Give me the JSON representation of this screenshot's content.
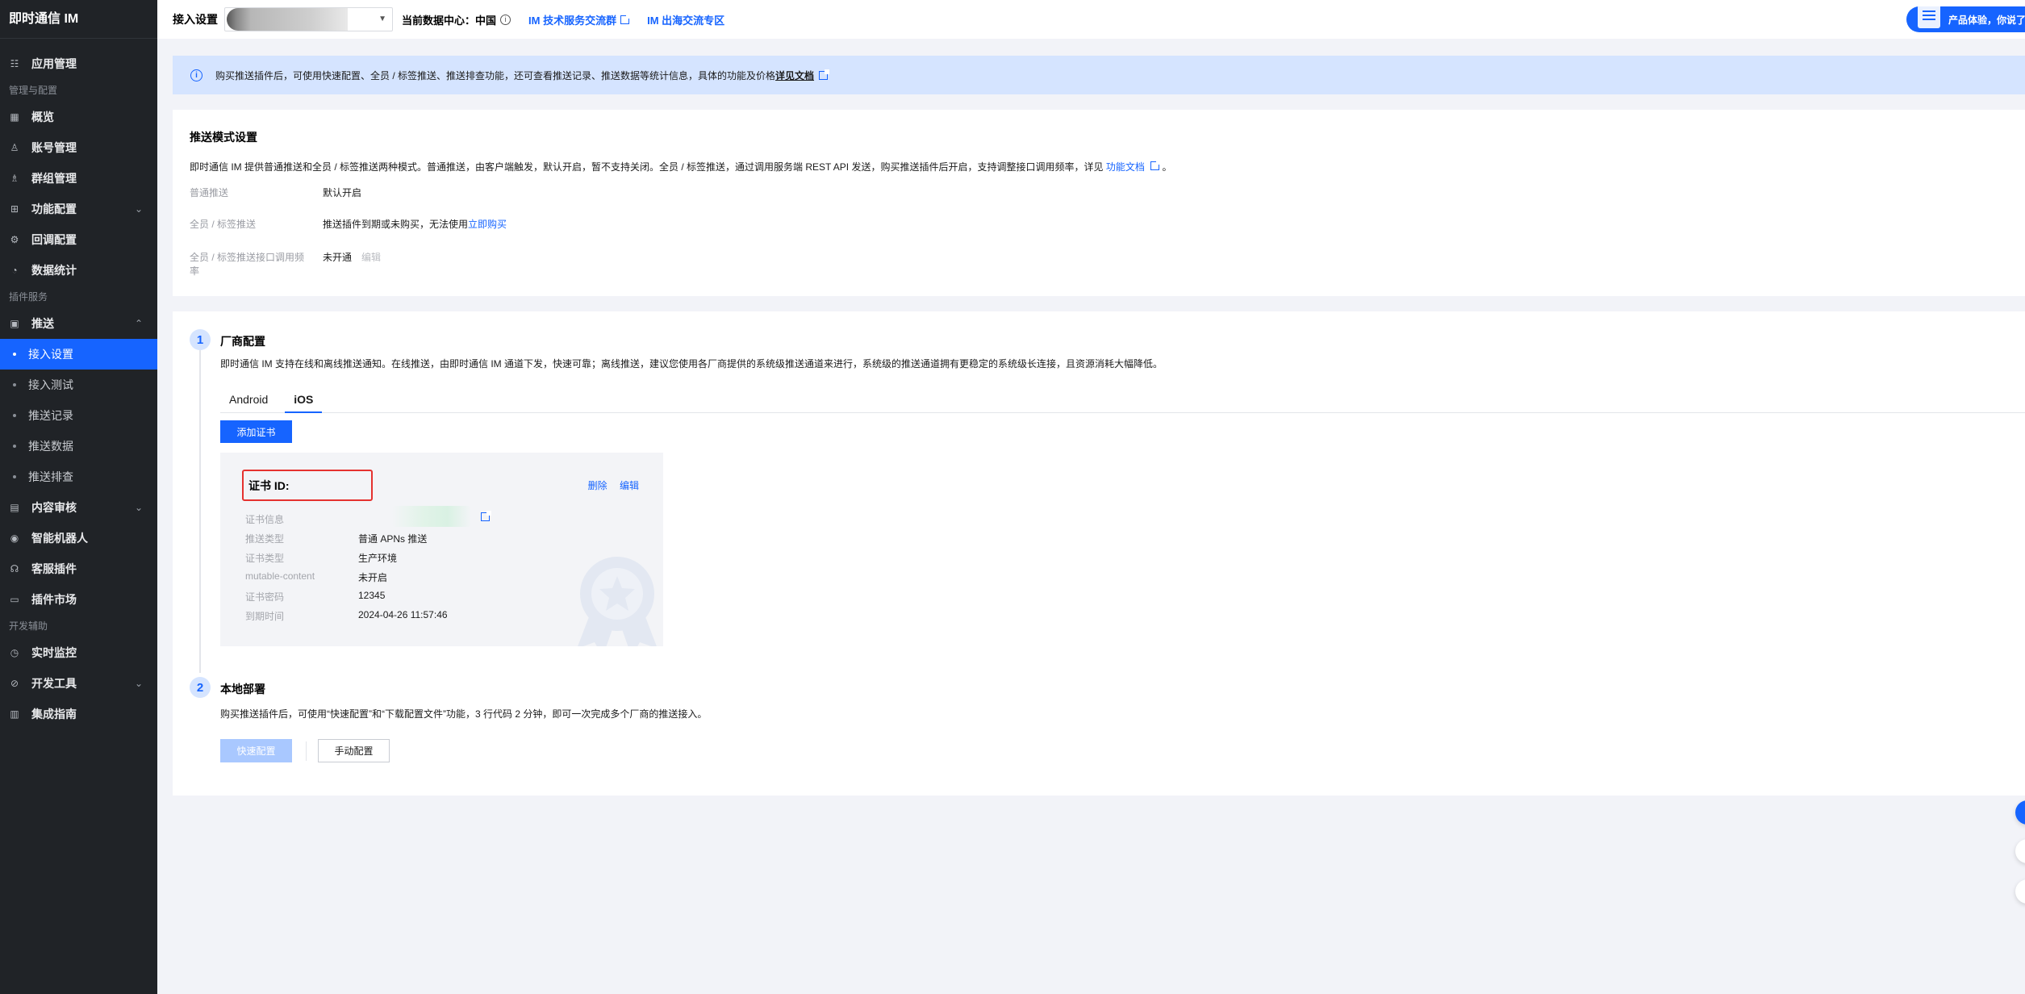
{
  "sidebar": {
    "brand": "即时通信 IM",
    "app_mgmt": "应用管理",
    "group_mgmt_label": "管理与配置",
    "overview": "概览",
    "account": "账号管理",
    "group": "群组管理",
    "feature": "功能配置",
    "callback": "回调配置",
    "stats": "数据统计",
    "group_plugin_label": "插件服务",
    "push": "推送",
    "push_sub": [
      "接入设置",
      "接入测试",
      "推送记录",
      "推送数据",
      "推送排查"
    ],
    "content_review": "内容审核",
    "robot": "智能机器人",
    "cs_plugin": "客服插件",
    "plugin_market": "插件市场",
    "group_dev_label": "开发辅助",
    "monitor": "实时监控",
    "devtools": "开发工具",
    "guide": "集成指南"
  },
  "topbar": {
    "title": "接入设置",
    "datacenter": "当前数据中心：中国",
    "link1": "IM 技术服务交流群",
    "link2": "IM 出海交流专区",
    "promo": "产品体验，你说了"
  },
  "notice": {
    "text": "购买推送插件后，可使用快速配置、全员 / 标签推送、推送排查功能，还可查看推送记录、推送数据等统计信息，具体的功能及价格",
    "link": "详见文档"
  },
  "mode_card": {
    "title": "推送模式设置",
    "desc": "即时通信 IM 提供普通推送和全员 / 标签推送两种模式。普通推送，由客户端触发，默认开启，暂不支持关闭。全员 / 标签推送，通过调用服务端 REST API 发送，购买推送插件后开启，支持调整接口调用频率，详见",
    "desc_link": "功能文档",
    "desc_end": "。",
    "rows": [
      {
        "k": "普通推送",
        "v": "默认开启"
      },
      {
        "k": "全员 / 标签推送",
        "v": "推送插件到期或未购买，无法使用",
        "link": "立即购买"
      },
      {
        "k1": "全员 / 标签推送接口调用频",
        "k2": "率",
        "v": "未开通",
        "edit": "编辑"
      }
    ]
  },
  "step1": {
    "num": "1",
    "title": "厂商配置",
    "desc": "即时通信 IM 支持在线和离线推送通知。在线推送，由即时通信 IM 通道下发，快速可靠；离线推送，建议您使用各厂商提供的系统级推送通道来进行，系统级的推送通道拥有更稳定的系统级长连接，且资源消耗大幅降低。",
    "tabs": [
      "Android",
      "iOS"
    ],
    "add_cert": "添加证书",
    "cert": {
      "id_label": "证书 ID:",
      "delete": "删除",
      "edit": "编辑",
      "rows": [
        {
          "k": "证书信息",
          "v": ""
        },
        {
          "k": "推送类型",
          "v": "普通 APNs 推送"
        },
        {
          "k": "证书类型",
          "v": "生产环境"
        },
        {
          "k": "mutable-content",
          "v": "未开启"
        },
        {
          "k": "证书密码",
          "v": "12345"
        },
        {
          "k": "到期时间",
          "v": "2024-04-26 11:57:46"
        }
      ]
    }
  },
  "step2": {
    "num": "2",
    "title": "本地部署",
    "desc": "购买推送插件后，可使用“快速配置”和“下载配置文件”功能，3 行代码 2 分钟，即可一次完成多个厂商的推送接入。",
    "quick": "快速配置",
    "manual": "手动配置"
  },
  "colors": {
    "accent": "#1664ff",
    "sidebar": "#202327",
    "notice": "#d5e4ff",
    "highlight": "#e5322f"
  }
}
